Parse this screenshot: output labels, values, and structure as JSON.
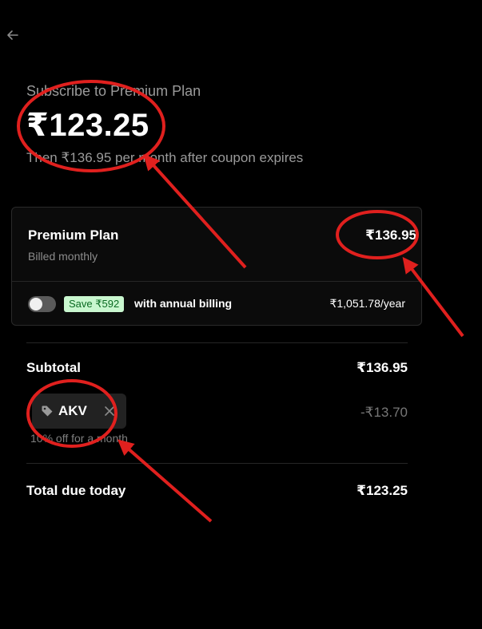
{
  "header": {
    "subtitle": "Subscribe to Premium Plan",
    "amount": "₹123.25",
    "then_text": "Then ₹136.95 per month after coupon expires"
  },
  "plan": {
    "name": "Premium Plan",
    "billing": "Billed monthly",
    "price": "₹136.95"
  },
  "annual": {
    "toggle_on": false,
    "save_badge": "Save ₹592",
    "label": "with annual billing",
    "price": "₹1,051.78/year"
  },
  "summary": {
    "subtotal_label": "Subtotal",
    "subtotal_value": "₹136.95",
    "coupon_code": "AKV",
    "discount_value": "-₹13.70",
    "discount_note": "10% off for a month",
    "total_label": "Total due today",
    "total_value": "₹123.25"
  },
  "colors": {
    "background": "#000000",
    "annotation": "#e0201e",
    "badge_bg": "#c9f7cf",
    "badge_text": "#0b6b22"
  },
  "icons": [
    "arrow-left-icon",
    "tag-icon",
    "close-icon"
  ]
}
